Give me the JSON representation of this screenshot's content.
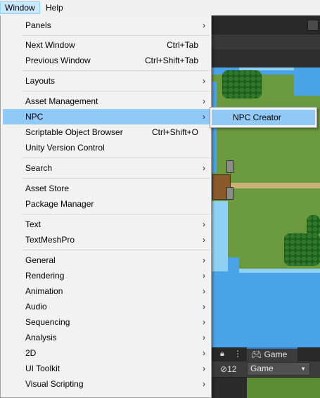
{
  "menubar": {
    "items": [
      {
        "label": "Window"
      },
      {
        "label": "Help"
      }
    ]
  },
  "menu": {
    "items": [
      {
        "label": "Panels",
        "shortcut": "",
        "submenu": true
      },
      {
        "label": "Next Window",
        "shortcut": "Ctrl+Tab",
        "submenu": false
      },
      {
        "label": "Previous Window",
        "shortcut": "Ctrl+Shift+Tab",
        "submenu": false
      },
      {
        "label": "Layouts",
        "shortcut": "",
        "submenu": true
      },
      {
        "label": "Asset Management",
        "shortcut": "",
        "submenu": true
      },
      {
        "label": "NPC",
        "shortcut": "",
        "submenu": true
      },
      {
        "label": "Scriptable Object Browser",
        "shortcut": "Ctrl+Shift+O",
        "submenu": false
      },
      {
        "label": "Unity Version Control",
        "shortcut": "",
        "submenu": false
      },
      {
        "label": "Search",
        "shortcut": "",
        "submenu": true
      },
      {
        "label": "Asset Store",
        "shortcut": "",
        "submenu": false
      },
      {
        "label": "Package Manager",
        "shortcut": "",
        "submenu": false
      },
      {
        "label": "Text",
        "shortcut": "",
        "submenu": true
      },
      {
        "label": "TextMeshPro",
        "shortcut": "",
        "submenu": true
      },
      {
        "label": "General",
        "shortcut": "",
        "submenu": true
      },
      {
        "label": "Rendering",
        "shortcut": "",
        "submenu": true
      },
      {
        "label": "Animation",
        "shortcut": "",
        "submenu": true
      },
      {
        "label": "Audio",
        "shortcut": "",
        "submenu": true
      },
      {
        "label": "Sequencing",
        "shortcut": "",
        "submenu": true
      },
      {
        "label": "Analysis",
        "shortcut": "",
        "submenu": true
      },
      {
        "label": "2D",
        "shortcut": "",
        "submenu": true
      },
      {
        "label": "UI Toolkit",
        "shortcut": "",
        "submenu": true
      },
      {
        "label": "Visual Scripting",
        "shortcut": "",
        "submenu": true
      }
    ],
    "chevron_icon": "chevron-right-icon",
    "highlight_color": "#91c9f7"
  },
  "submenu": {
    "items": [
      {
        "label": "NPC Creator"
      }
    ]
  },
  "editor": {
    "game_tab_label": "Game",
    "game_dropdown_value": "Game",
    "hidden_count": "12"
  }
}
